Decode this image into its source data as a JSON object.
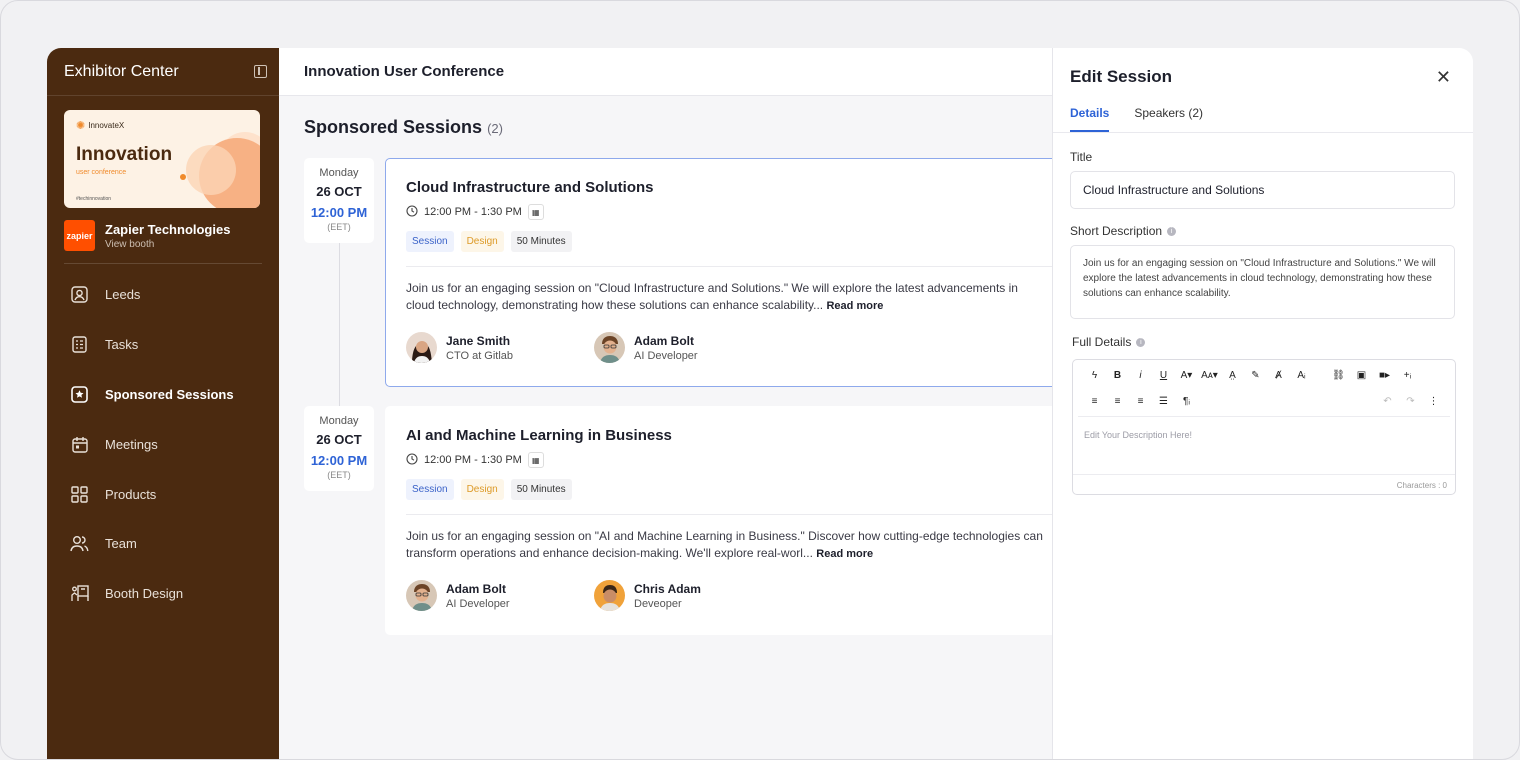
{
  "sidebar": {
    "title": "Exhibitor Center",
    "event_card": {
      "brand": "InnovateX",
      "title": "Innovation",
      "subtitle": "user conference",
      "hashtag": "#techinnovation"
    },
    "booth": {
      "logo_text": "zapier",
      "name": "Zapier Technologies",
      "link": "View booth"
    },
    "items": [
      {
        "label": "Leeds",
        "icon": "user-badge-icon"
      },
      {
        "label": "Tasks",
        "icon": "checklist-icon"
      },
      {
        "label": "Sponsored Sessions",
        "icon": "star-icon",
        "active": true
      },
      {
        "label": "Meetings",
        "icon": "calendar-icon"
      },
      {
        "label": "Products",
        "icon": "grid-icon"
      },
      {
        "label": "Team",
        "icon": "team-icon"
      },
      {
        "label": "Booth Design",
        "icon": "booth-icon"
      }
    ]
  },
  "topbar": {
    "title": "Innovation User Conference"
  },
  "main": {
    "section_title": "Sponsored Sessions",
    "section_count": "(2)",
    "sessions": [
      {
        "day": "Monday",
        "date": "26 OCT",
        "time": "12:00 PM",
        "tz": "(EET)",
        "title": "Cloud Infrastructure and Solutions",
        "time_range": "12:00 PM - 1:30 PM",
        "tags": [
          "Session",
          "Design",
          "50 Minutes"
        ],
        "desc": "Join us for an engaging session on \"Cloud Infrastructure and Solutions.\" We will explore the latest advancements in cloud technology, demonstrating how these solutions can enhance scalability...",
        "read_more": "Read more",
        "speakers": [
          {
            "name": "Jane Smith",
            "role": "CTO at Gitlab"
          },
          {
            "name": "Adam Bolt",
            "role": "AI Developer"
          }
        ]
      },
      {
        "day": "Monday",
        "date": "26 OCT",
        "time": "12:00 PM",
        "tz": "(EET)",
        "title": "AI and Machine Learning in Business",
        "time_range": "12:00 PM - 1:30 PM",
        "tags": [
          "Session",
          "Design",
          "50 Minutes"
        ],
        "desc": "Join us for an engaging session on \"AI and Machine Learning in Business.\" Discover how cutting-edge technologies can transform operations and enhance decision-making. We'll explore real-worl...",
        "read_more": "Read more",
        "speakers": [
          {
            "name": "Adam Bolt",
            "role": "AI Developer"
          },
          {
            "name": "Chris Adam",
            "role": "Deveoper"
          }
        ]
      }
    ]
  },
  "panel": {
    "title": "Edit Session",
    "tabs": [
      "Details",
      "Speakers (2)"
    ],
    "title_label": "Title",
    "title_value": "Cloud Infrastructure and Solutions",
    "short_desc_label": "Short Description",
    "short_desc_value": "Join us for an engaging session on \"Cloud Infrastructure and Solutions.\" We will explore the latest advancements in cloud technology, demonstrating how these solutions can enhance scalability.",
    "full_details_label": "Full Details",
    "editor_placeholder": "Edit Your Description Here!",
    "char_count": "Characters : 0"
  },
  "colors": {
    "sidebar_bg": "#4b2a10",
    "accent_blue": "#2e63d6",
    "zapier_orange": "#ff4f00"
  }
}
